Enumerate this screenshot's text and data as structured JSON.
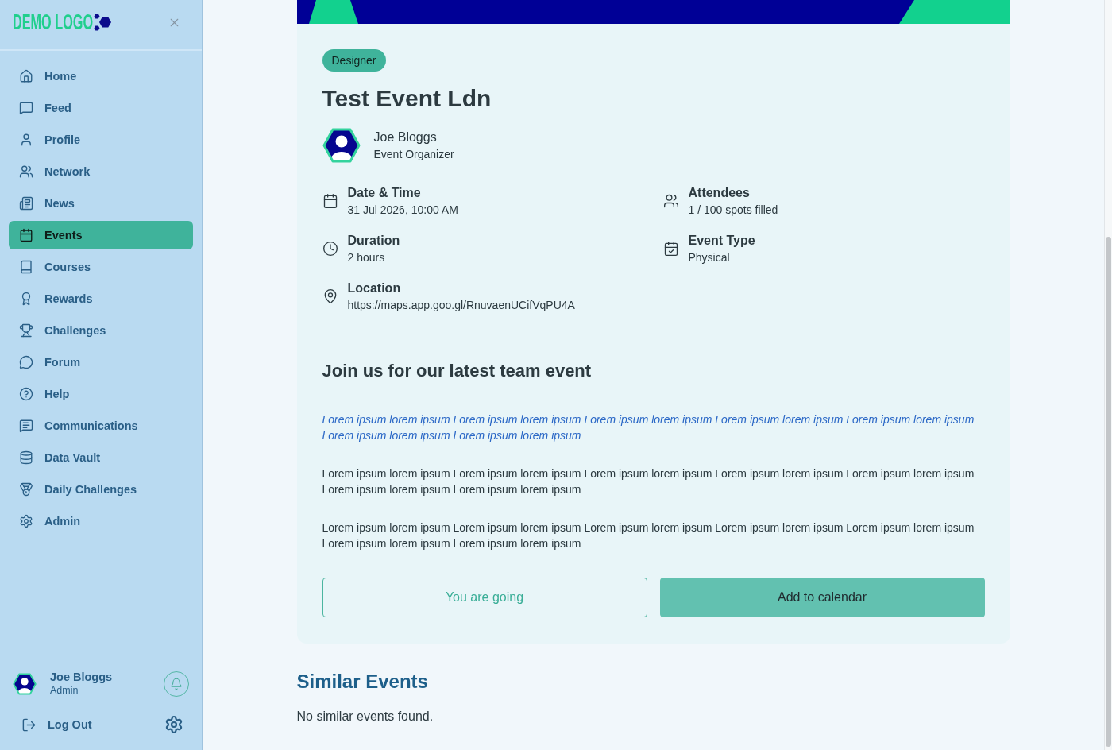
{
  "sidebar": {
    "logo": "DEMO LOGO",
    "nav": [
      {
        "label": "Home",
        "selected": false
      },
      {
        "label": "Feed",
        "selected": false
      },
      {
        "label": "Profile",
        "selected": false
      },
      {
        "label": "Network",
        "selected": false
      },
      {
        "label": "News",
        "selected": false
      },
      {
        "label": "Events",
        "selected": true
      },
      {
        "label": "Courses",
        "selected": false
      },
      {
        "label": "Rewards",
        "selected": false
      },
      {
        "label": "Challenges",
        "selected": false
      },
      {
        "label": "Forum",
        "selected": false
      },
      {
        "label": "Help",
        "selected": false
      },
      {
        "label": "Communications",
        "selected": false
      },
      {
        "label": "Data Vault",
        "selected": false
      },
      {
        "label": "Daily Challenges",
        "selected": false
      },
      {
        "label": "Admin",
        "selected": false
      }
    ],
    "user": {
      "name": "Joe Bloggs",
      "role": "Admin"
    },
    "logout": "Log Out"
  },
  "event": {
    "tag": "Designer",
    "title": "Test Event Ldn",
    "organizer": {
      "name": "Joe Bloggs",
      "role": "Event Organizer"
    },
    "details": [
      {
        "label": "Date & Time",
        "value": "31 Jul 2026, 10:00 AM"
      },
      {
        "label": "Attendees",
        "value": "1 / 100 spots filled"
      },
      {
        "label": "Duration",
        "value": "2 hours"
      },
      {
        "label": "Event Type",
        "value": "Physical"
      },
      {
        "label": "Location",
        "value": "https://maps.app.goo.gl/RnuvaenUCifVqPU4A"
      }
    ],
    "heading": "Join us for our latest team event",
    "paragraphs": [
      {
        "kind": "lead",
        "text": "Lorem ipsum lorem ipsum Lorem ipsum lorem ipsum Lorem ipsum lorem ipsum Lorem ipsum lorem ipsum Lorem ipsum lorem ipsum Lorem ipsum lorem ipsum Lorem ipsum lorem ipsum"
      },
      {
        "kind": "body",
        "text": "Lorem ipsum lorem ipsum Lorem ipsum lorem ipsum Lorem ipsum lorem ipsum Lorem ipsum lorem ipsum Lorem ipsum lorem ipsum Lorem ipsum lorem ipsum Lorem ipsum lorem ipsum"
      },
      {
        "kind": "body",
        "text": "Lorem ipsum lorem ipsum Lorem ipsum lorem ipsum Lorem ipsum lorem ipsum Lorem ipsum lorem ipsum Lorem ipsum lorem ipsum Lorem ipsum lorem ipsum Lorem ipsum lorem ipsum"
      }
    ],
    "buttons": [
      {
        "kind": "outline",
        "label": "You are going"
      },
      {
        "kind": "filled",
        "label": "Add to calendar"
      }
    ]
  },
  "similar_events": {
    "title": "Similar Events",
    "empty_text": "No similar events found."
  }
}
